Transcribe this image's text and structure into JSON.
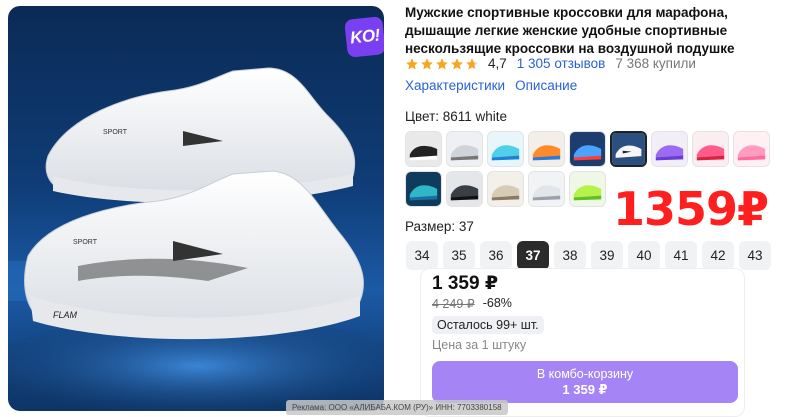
{
  "product": {
    "title": "Мужские спортивные кроссовки для марафона, дышащие легкие женские удобные спортивные нескользящие кроссовки на воздушной подушке",
    "badge": "KO!",
    "image_text": {
      "shoe_top": "SPORT",
      "shoe_bottom": "SPORT",
      "sole_logo": "FLAM"
    }
  },
  "rating": {
    "stars": 4.7,
    "value": "4,7",
    "reviews": "1 305 отзывов",
    "bought": "7 368 купили"
  },
  "tabs": [
    "Характеристики",
    "Описание"
  ],
  "color": {
    "label": "Цвет: 8611 white",
    "swatches": [
      {
        "name": "black-white",
        "selected": false
      },
      {
        "name": "white-grey",
        "selected": false
      },
      {
        "name": "aqua-blue",
        "selected": false
      },
      {
        "name": "orange-blue",
        "selected": false
      },
      {
        "name": "blue-red",
        "selected": false
      },
      {
        "name": "white-black",
        "selected": true
      },
      {
        "name": "purple",
        "selected": false
      },
      {
        "name": "pink-red",
        "selected": false
      },
      {
        "name": "pink",
        "selected": false
      },
      {
        "name": "teal",
        "selected": false
      },
      {
        "name": "dark",
        "selected": false
      },
      {
        "name": "beige",
        "selected": false
      },
      {
        "name": "grey-white",
        "selected": false
      },
      {
        "name": "lime-green",
        "selected": false
      }
    ]
  },
  "promo_price": "1359₽",
  "size": {
    "label": "Размер: 37",
    "options": [
      "34",
      "35",
      "36",
      "37",
      "38",
      "39",
      "40",
      "41",
      "42",
      "43"
    ],
    "selected": "37"
  },
  "pricing": {
    "price": "1 359 ₽",
    "old_price": "4 249 ₽",
    "discount": "-68%",
    "stock": "Осталось 99+ шт.",
    "unit_note": "Цена за 1 штуку"
  },
  "cart_button": {
    "label": "В комбо-корзину",
    "price": "1 359 ₽"
  },
  "ad_note": "Реклама: ООО «АЛИБАБА.КОМ (РУ)» ИНН: 7703380158",
  "colors": {
    "accent_blue": "#2a62d6",
    "promo_red": "#ff1f1f",
    "button_purple": "#a585f5",
    "badge_purple": "#7b3ff2",
    "star_orange": "#f5a623"
  }
}
